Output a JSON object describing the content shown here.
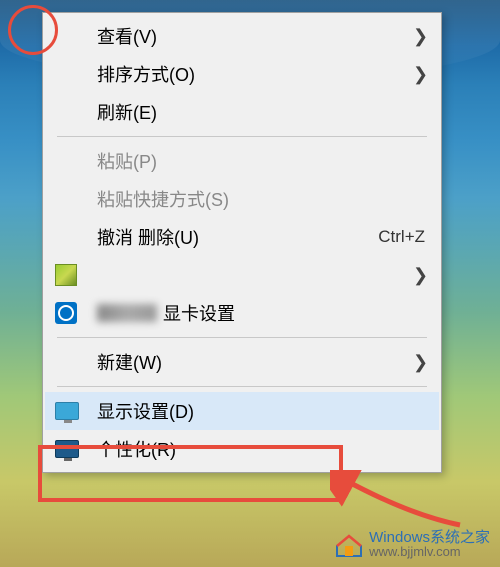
{
  "menu": {
    "items": [
      {
        "label": "查看(V)",
        "has_submenu": true
      },
      {
        "label": "排序方式(O)",
        "has_submenu": true
      },
      {
        "label": "刷新(E)"
      },
      {
        "type": "separator"
      },
      {
        "label": "粘贴(P)",
        "disabled": true
      },
      {
        "label": "粘贴快捷方式(S)",
        "disabled": true
      },
      {
        "label": "撤消 删除(U)",
        "shortcut": "Ctrl+Z"
      },
      {
        "label": "",
        "icon": "green-square-icon",
        "blurred": true,
        "has_submenu": true
      },
      {
        "label": "显卡设置",
        "icon": "intel-icon",
        "blurred_prefix": true
      },
      {
        "type": "separator"
      },
      {
        "label": "新建(W)",
        "has_submenu": true
      },
      {
        "type": "separator"
      },
      {
        "label": "显示设置(D)",
        "icon": "monitor-icon",
        "highlighted": true
      },
      {
        "label": "个性化(R)",
        "icon": "monitor-dark-icon"
      }
    ]
  },
  "watermark": {
    "brand": "Windows系统之家",
    "url": "www.bjjmlv.com"
  }
}
